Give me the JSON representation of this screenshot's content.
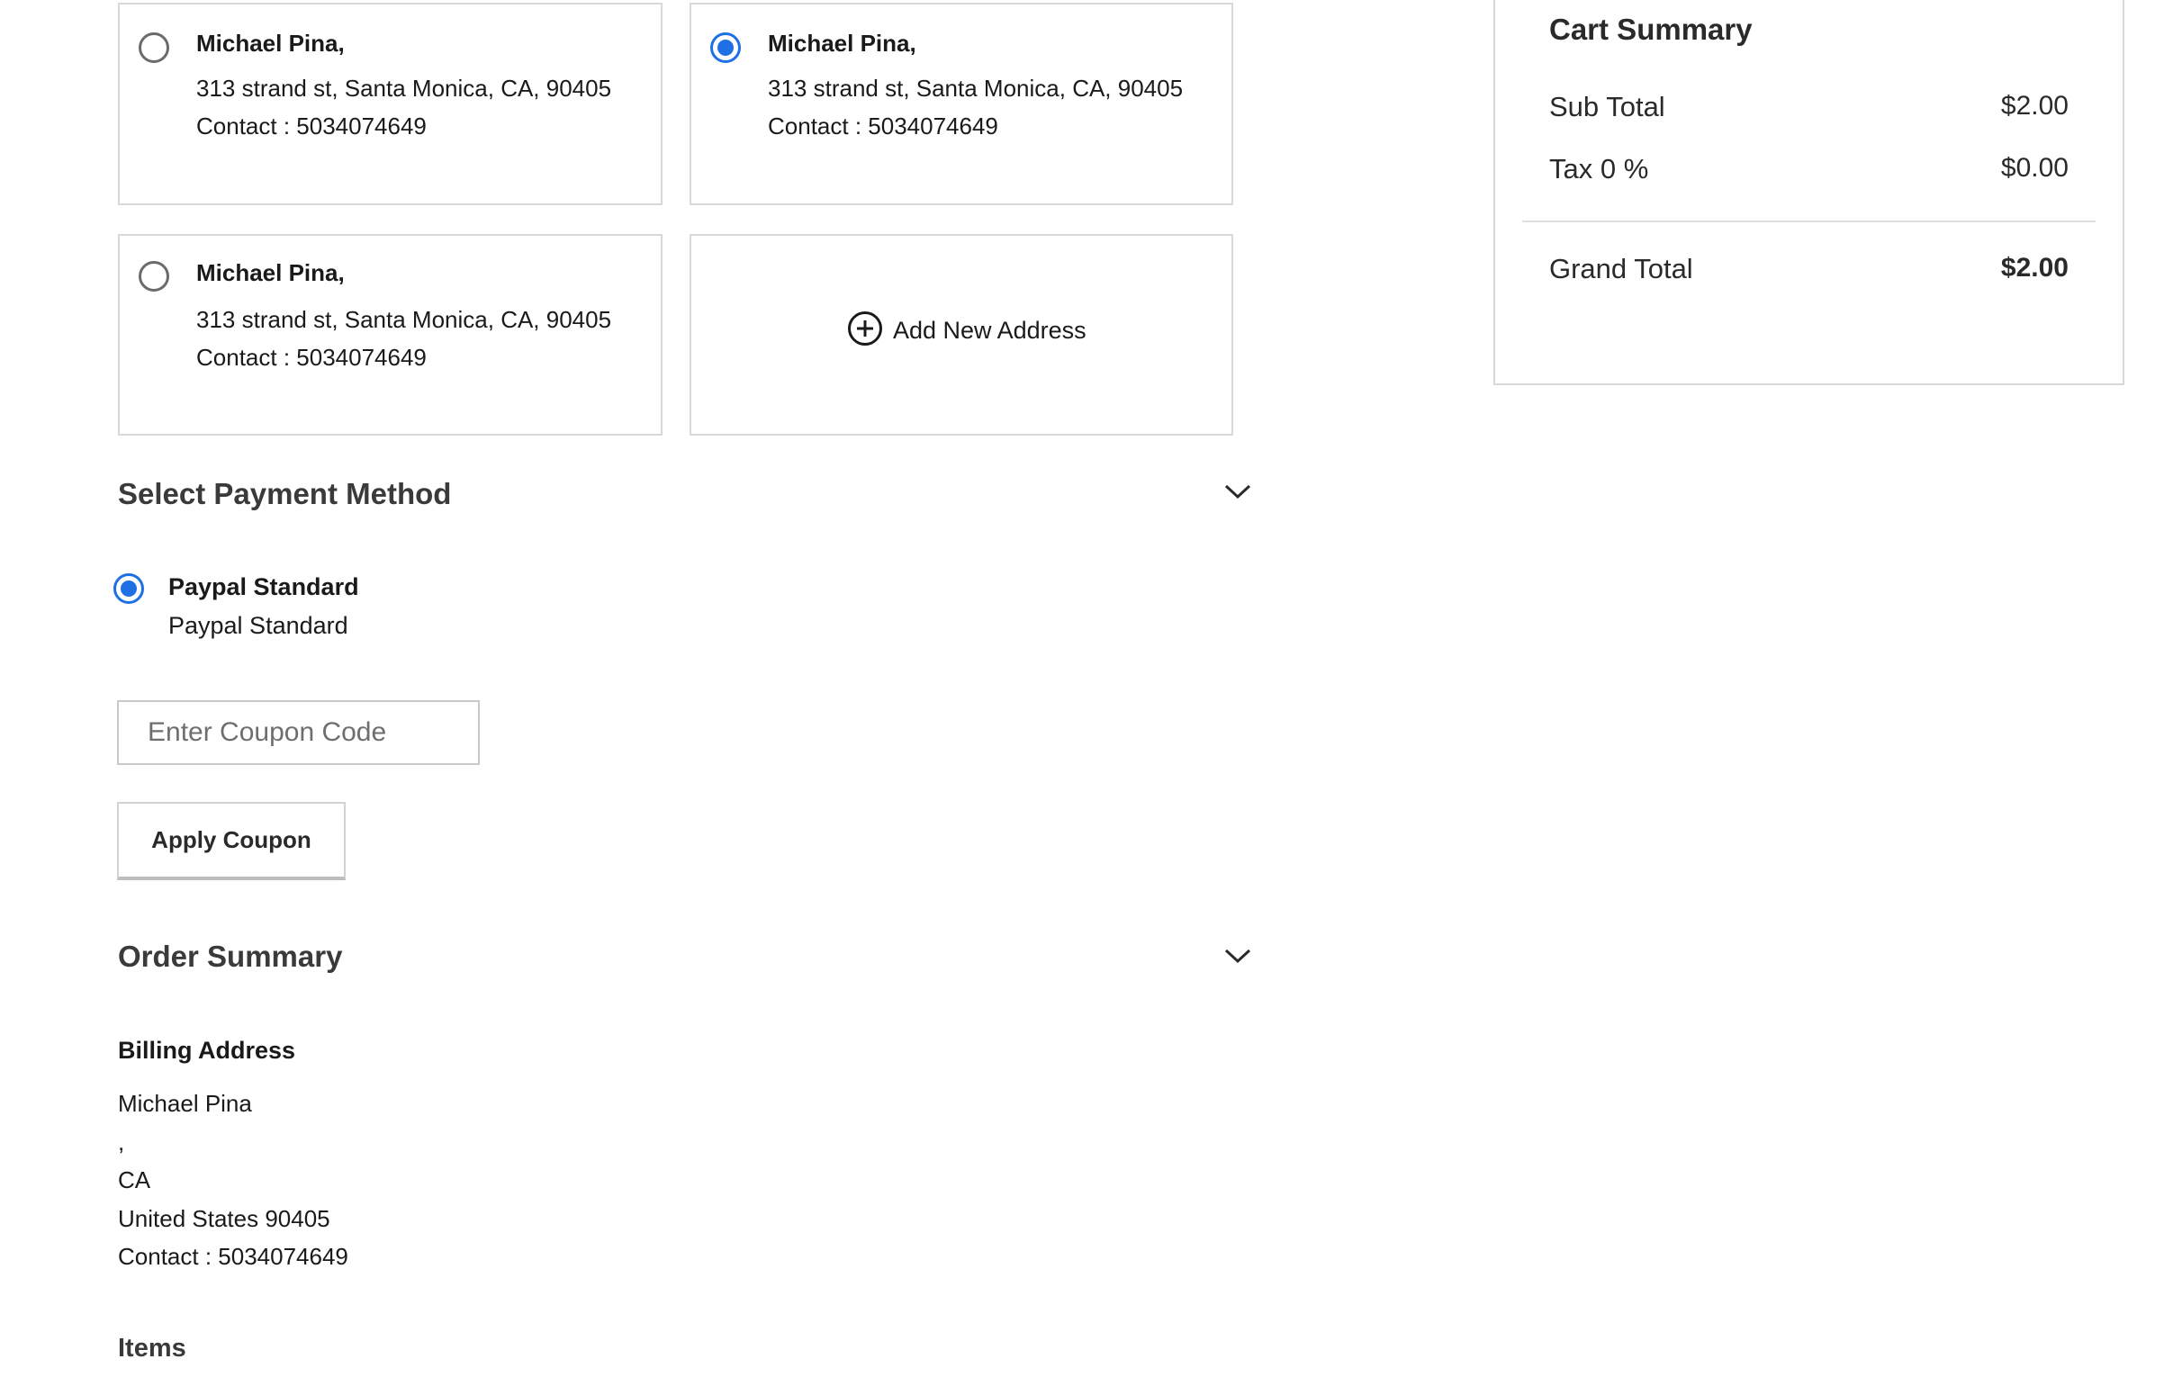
{
  "addresses": [
    {
      "name": "Michael Pina,",
      "street": "313 strand st, Santa Monica, CA, 90405",
      "contact": "Contact : 5034074649",
      "selected": false
    },
    {
      "name": "Michael Pina,",
      "street": "313 strand st, Santa Monica, CA, 90405",
      "contact": "Contact : 5034074649",
      "selected": true
    },
    {
      "name": "Michael Pina,",
      "street": "313 strand st, Santa Monica, CA, 90405",
      "contact": "Contact : 5034074649",
      "selected": false
    }
  ],
  "add_address": {
    "label": "Add New Address",
    "icon": "plus-circle-icon"
  },
  "payment": {
    "title": "Select Payment Method",
    "method_title": "Paypal Standard",
    "method_description": "Paypal Standard",
    "selected": true
  },
  "coupon": {
    "placeholder": "Enter Coupon Code",
    "value": "",
    "apply_label": "Apply Coupon"
  },
  "order_summary": {
    "title": "Order Summary",
    "billing_title": "Billing Address",
    "billing_lines": [
      "Michael Pina",
      ",",
      "CA",
      "United States 90405",
      "Contact : 5034074649"
    ],
    "items_title": "Items"
  },
  "cart_summary": {
    "title": "Cart Summary",
    "subtotal_label": "Sub Total",
    "subtotal_value": "$2.00",
    "tax_label": "Tax 0 %",
    "tax_value": "$0.00",
    "grand_total_label": "Grand Total",
    "grand_total_value": "$2.00"
  },
  "colors": {
    "accent": "#1f6fe5",
    "border": "#d8d8d8"
  }
}
